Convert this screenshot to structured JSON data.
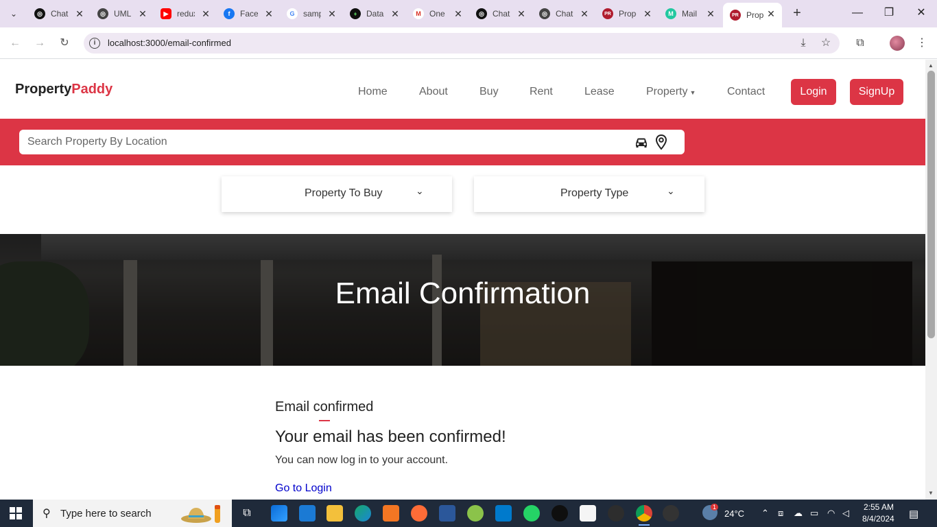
{
  "browser": {
    "tabs": [
      {
        "label": "ChatGPT",
        "icon": "chatgpt-icon",
        "color": "#111111",
        "glyph": "◎"
      },
      {
        "label": "UML",
        "icon": "chatgpt-icon",
        "color": "#444444",
        "glyph": "◎"
      },
      {
        "label": "redux",
        "icon": "youtube-icon",
        "color": "#ff0000",
        "glyph": "▶"
      },
      {
        "label": "Facebook",
        "icon": "facebook-icon",
        "color": "#1877f2",
        "glyph": "f"
      },
      {
        "label": "sample",
        "icon": "google-icon",
        "color": "#ffffff",
        "glyph": "G"
      },
      {
        "label": "Data",
        "icon": "mongodb-icon",
        "color": "#0f0f0f",
        "glyph": "♦"
      },
      {
        "label": "One",
        "icon": "gmail-icon",
        "color": "#ffffff",
        "glyph": "M"
      },
      {
        "label": "ChatGPT",
        "icon": "chatgpt-icon",
        "color": "#111111",
        "glyph": "◎"
      },
      {
        "label": "ChatGPT",
        "icon": "chatgpt-icon",
        "color": "#444444",
        "glyph": "◎"
      },
      {
        "label": "Property",
        "icon": "propertypaddy-icon",
        "color": "#b01c2e",
        "glyph": "PR"
      },
      {
        "label": "Mail",
        "icon": "mailtrap-icon",
        "color": "#22c8a0",
        "glyph": "M"
      },
      {
        "label": "Property",
        "icon": "propertypaddy-icon",
        "color": "#b01c2e",
        "glyph": "PR"
      }
    ],
    "url": "localhost:3000/email-confirmed"
  },
  "site": {
    "logo_main": "Property",
    "logo_accent": "Paddy",
    "nav": [
      "Home",
      "About",
      "Buy",
      "Rent",
      "Lease",
      "Property",
      "Contact"
    ],
    "login_label": "Login",
    "signup_label": "SignUp",
    "search_placeholder": "Search Property By Location",
    "filter_buy": "Property To Buy",
    "filter_type": "Property Type",
    "hero_title": "Email Confirmation",
    "section_heading": "Email confirmed",
    "confirm_title": "Your email has been confirmed!",
    "confirm_text": "You can now log in to your account.",
    "login_link": "Go to Login",
    "accent_color": "#dc3545"
  },
  "taskbar": {
    "search_placeholder": "Type here to search",
    "weather": "24°C",
    "weather_badge": "1",
    "time": "2:55 AM",
    "date": "8/4/2024"
  }
}
